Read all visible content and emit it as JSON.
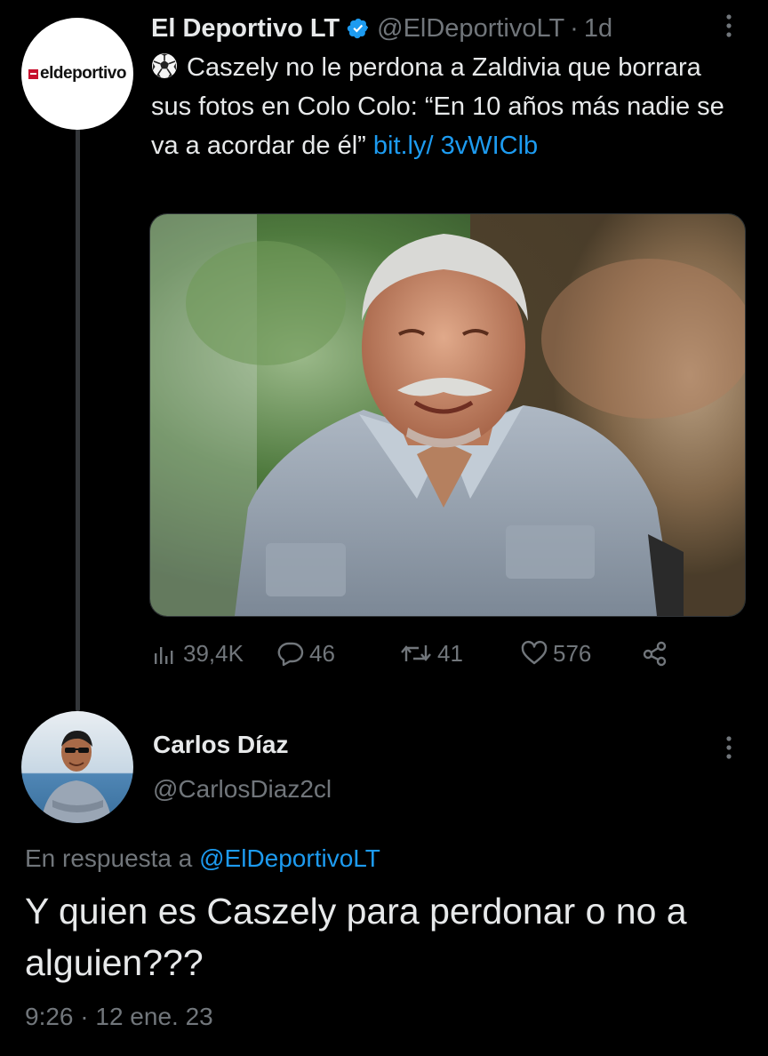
{
  "tweet": {
    "author_name": "El Deportivo LT",
    "author_handle": "@ElDeportivoLT",
    "separator": "·",
    "time_ago": "1d",
    "logo_text": "eldeportivo",
    "text_main": "Caszely no le perdona a Zaldivia que borrara sus fotos en Colo Colo: “En 10 años más nadie se va a acordar de él”",
    "link_text": "bit.ly/ 3vWIClb",
    "stats": {
      "views": "39,4K",
      "replies": "46",
      "retweets": "41",
      "likes": "576"
    }
  },
  "reply": {
    "author_name": "Carlos Díaz",
    "author_handle": "@CarlosDiaz2cl",
    "in_reply_label": "En respuesta a",
    "in_reply_handle": "@ElDeportivoLT",
    "text": "Y quien es Caszely para perdonar o no a alguien???",
    "timestamp": "9:26 · 12 ene. 23"
  },
  "colors": {
    "background": "#000000",
    "text": "#e7e9ea",
    "muted": "#71767b",
    "link": "#1d9bf0"
  },
  "icons": [
    "verified-badge-icon",
    "soccer-ball-icon",
    "more-options-icon",
    "views-icon",
    "reply-icon",
    "retweet-icon",
    "like-icon",
    "share-icon"
  ]
}
